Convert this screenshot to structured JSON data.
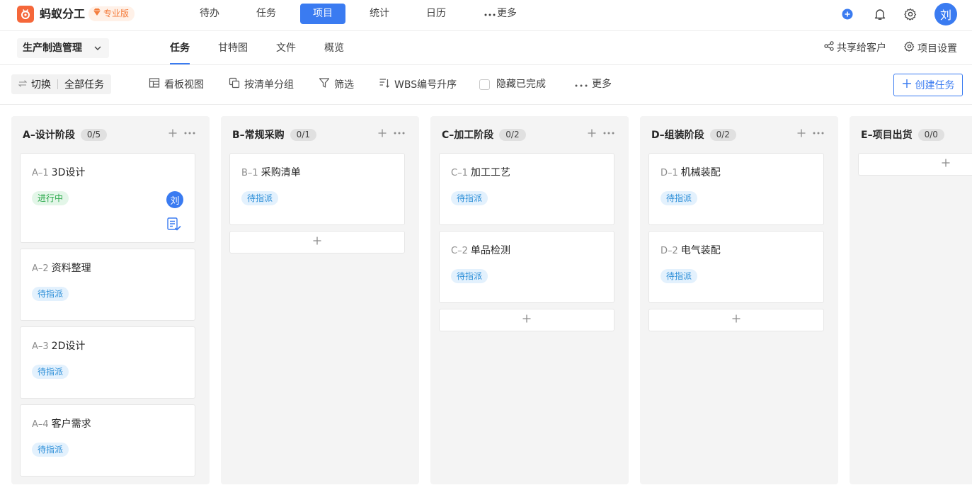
{
  "topbar": {
    "app_name": "蚂蚁分工",
    "pro_badge": "专业版",
    "nav": [
      "待办",
      "任务",
      "项目",
      "统计",
      "日历",
      "更多"
    ],
    "active_nav": "项目",
    "user_avatar": "刘"
  },
  "subbar": {
    "project_name": "生产制造管理",
    "tabs": [
      "任务",
      "甘特图",
      "文件",
      "概览"
    ],
    "active_tab": "任务",
    "share_label": "共享给客户",
    "settings_label": "项目设置"
  },
  "toolbar": {
    "switch_label": "切换",
    "scope_label": "全部任务",
    "board_view": "看板视图",
    "group_by": "按清单分组",
    "filter": "筛选",
    "sort": "WBS编号升序",
    "hide_done": "隐藏已完成",
    "more": "更多",
    "create_task": "创建任务"
  },
  "columns": [
    {
      "title": "A–设计阶段",
      "count": "0/5",
      "cards": [
        {
          "code": "A–1",
          "title": "3D设计",
          "status": "进行中",
          "assignee": "刘"
        },
        {
          "code": "A–2",
          "title": "资料整理",
          "status": "待指派"
        },
        {
          "code": "A–3",
          "title": "2D设计",
          "status": "待指派"
        },
        {
          "code": "A–4",
          "title": "客户需求",
          "status": "待指派"
        }
      ]
    },
    {
      "title": "B–常规采购",
      "count": "0/1",
      "cards": [
        {
          "code": "B–1",
          "title": "采购清单",
          "status": "待指派"
        }
      ]
    },
    {
      "title": "C–加工阶段",
      "count": "0/2",
      "cards": [
        {
          "code": "C–1",
          "title": "加工工艺",
          "status": "待指派"
        },
        {
          "code": "C–2",
          "title": "单品检测",
          "status": "待指派"
        }
      ]
    },
    {
      "title": "D–组装阶段",
      "count": "0/2",
      "cards": [
        {
          "code": "D–1",
          "title": "机械装配",
          "status": "待指派"
        },
        {
          "code": "D–2",
          "title": "电气装配",
          "status": "待指派"
        }
      ]
    },
    {
      "title": "E–项目出货",
      "count": "0/0",
      "cards": []
    }
  ],
  "colors": {
    "accent": "#3a7bf1",
    "brand": "#f5673a",
    "status_pending": "#2d8fd8",
    "status_in_progress": "#2aa84a"
  }
}
